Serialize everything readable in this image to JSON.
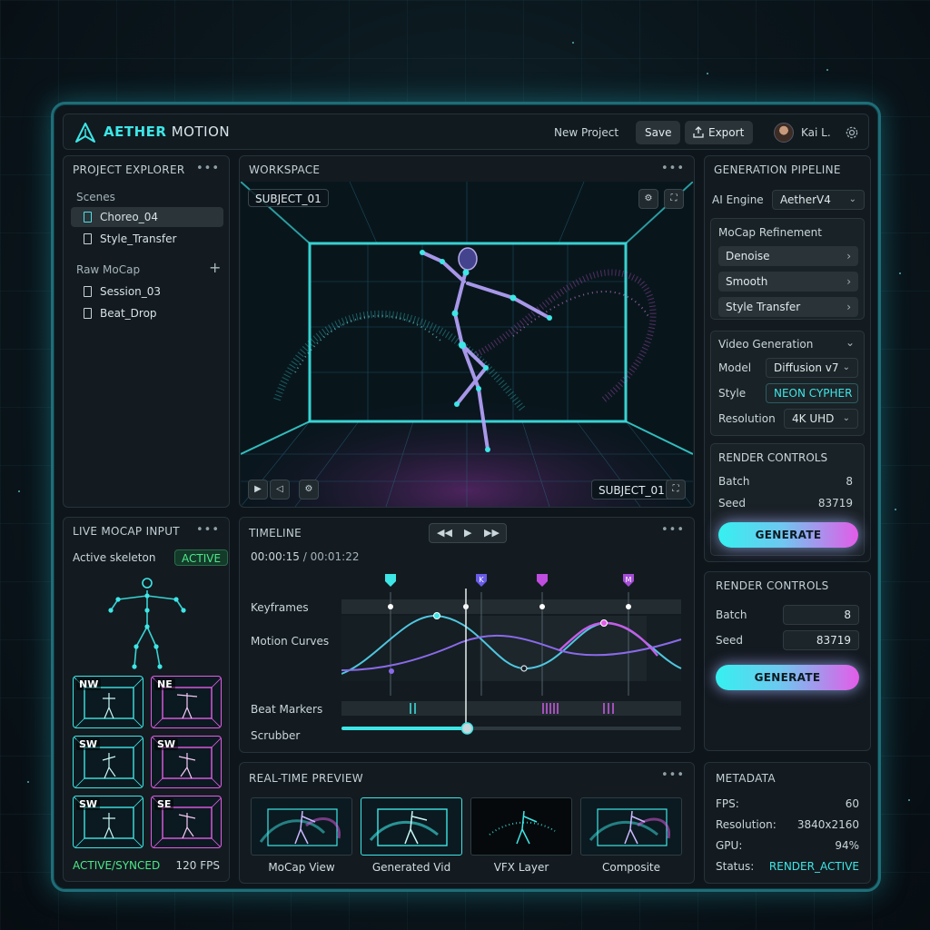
{
  "header": {
    "brand_primary": "AETHER",
    "brand_secondary": "MOTION",
    "new_project": "New Project",
    "save": "Save",
    "export": "Export",
    "user_name": "Kai L."
  },
  "explorer": {
    "title": "PROJECT EXPLORER",
    "scenes_label": "Scenes",
    "scenes": [
      "Choreo_04",
      "Style_Transfer"
    ],
    "rawmocap_label": "Raw MoCap",
    "rawmocap": [
      "Session_03",
      "Beat_Drop"
    ]
  },
  "workspace": {
    "title": "WORKSPACE",
    "subject_top": "SUBJECT_01",
    "subject_bottom": "SUBJECT_01"
  },
  "pipeline": {
    "title": "GENERATION PIPELINE",
    "ai_engine_label": "AI Engine",
    "ai_engine_value": "AetherV4",
    "mocap_refinement": "MoCap Refinement",
    "refinement_steps": [
      "Denoise",
      "Smooth",
      "Style Transfer"
    ],
    "video_generation": "Video Generation",
    "model_label": "Model",
    "model_value": "Diffusion v7",
    "style_label": "Style",
    "style_value": "NEON CYPHER",
    "resolution_label": "Resolution",
    "resolution_value": "4K UHD",
    "render_title": "RENDER CONTROLS",
    "batch_label": "Batch",
    "batch_value": "8",
    "seed_label": "Seed",
    "seed_value": "83719",
    "generate": "GENERATE"
  },
  "render2": {
    "title": "RENDER CONTROLS",
    "batch_label": "Batch",
    "batch_value": "8",
    "seed_label": "Seed",
    "seed_value": "83719",
    "generate": "GENERATE"
  },
  "mocap": {
    "title": "LIVE MOCAP INPUT",
    "active_skeleton": "Active skeleton",
    "active_badge": "ACTIVE",
    "thumbs": [
      "NW",
      "NE",
      "SW",
      "SW",
      "SW",
      "SE"
    ],
    "status": "ACTIVE/SYNCED",
    "fps": "120 FPS"
  },
  "timeline": {
    "title": "TIMELINE",
    "current_time": "00:00:15",
    "total_time": "/ 00:01:22",
    "keyframes_label": "Keyframes",
    "motion_curves_label": "Motion Curves",
    "beat_markers_label": "Beat Markers",
    "scrubber_label": "Scrubber",
    "marker_labels": [
      "K",
      "M"
    ],
    "scrubber_progress": 0.37
  },
  "preview": {
    "title": "REAL-TIME PREVIEW",
    "items": [
      "MoCap View",
      "Generated Vid",
      "VFX Layer",
      "Composite"
    ]
  },
  "metadata": {
    "title": "METADATA",
    "fps_label": "FPS:",
    "fps_value": "60",
    "resolution_label": "Resolution:",
    "resolution_value": "3840x2160",
    "gpu_label": "GPU:",
    "gpu_value": "94%",
    "status_label": "Status:",
    "status_value": "RENDER_ACTIVE"
  },
  "colors": {
    "accent_cyan": "#3ee6e6",
    "accent_magenta": "#e35ce8",
    "active_green": "#4ee88a"
  }
}
